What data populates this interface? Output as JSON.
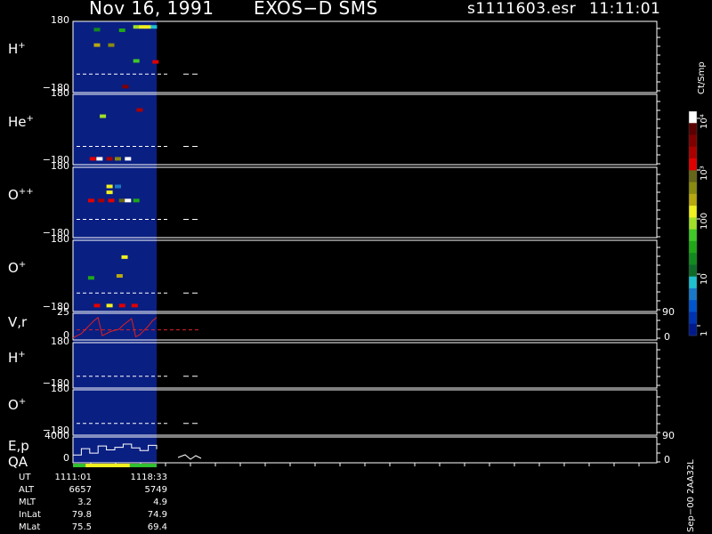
{
  "header": {
    "date": "Nov 16, 1991",
    "instrument": "EXOS−D SMS",
    "file": "s1111603.esr",
    "time": "11:11:01"
  },
  "colors": {
    "background": "#000000",
    "data_region": "#0a1f82",
    "frame": "#ffffff",
    "velocity_trace": "#e02020",
    "qa_green": "#30c030",
    "qa_yellow": "#f0f020"
  },
  "panels": [
    {
      "id": "H+",
      "label": "H",
      "sup": "+",
      "ymax": "180",
      "ymin": "−180"
    },
    {
      "id": "He+",
      "label": "He",
      "sup": "+",
      "ymax": "180",
      "ymin": "−180"
    },
    {
      "id": "O++",
      "label": "O",
      "sup": "++",
      "ymax": "180",
      "ymin": "−180"
    },
    {
      "id": "O+",
      "label": "O",
      "sup": "+",
      "ymax": "180",
      "ymin": "−180"
    },
    {
      "id": "Vr",
      "label": "V,r",
      "sup": "",
      "ymax": "25",
      "ymin": "0",
      "rmax": "90",
      "rmin": "0"
    },
    {
      "id": "H+2",
      "label": "H",
      "sup": "+",
      "ymax": "180",
      "ymin": "−180"
    },
    {
      "id": "O+2",
      "label": "O",
      "sup": "+",
      "ymax": "180",
      "ymin": "−180"
    },
    {
      "id": "Ep",
      "label": "E,p",
      "sup": "",
      "ymax": "4000",
      "ymin": "0",
      "rmax": "90",
      "rmin": "0"
    }
  ],
  "qa_label": "QA",
  "colorbar": {
    "unit": "Ct/Smp",
    "tick_labels": [
      "10⁴",
      "10³",
      "100",
      "10",
      "1"
    ],
    "colors": [
      "#001a8c",
      "#0033b0",
      "#0055cc",
      "#1a78c8",
      "#20c0d0",
      "#0f6a2a",
      "#138a20",
      "#20a818",
      "#40c828",
      "#a0e028",
      "#f0f020",
      "#b8a810",
      "#8a8a10",
      "#666618",
      "#e00000",
      "#aa0000",
      "#800000",
      "#5a0000",
      "#ffffff"
    ]
  },
  "ephemeris": {
    "rows": [
      {
        "name": "UT",
        "v1": "1111:01",
        "v2": "1118:33"
      },
      {
        "name": "ALT",
        "v1": "6657",
        "v2": "5749"
      },
      {
        "name": "MLT",
        "v1": "3.2",
        "v2": "4.9"
      },
      {
        "name": "InLat",
        "v1": "79.8",
        "v2": "74.9"
      },
      {
        "name": "MLat",
        "v1": "75.5",
        "v2": "69.4"
      }
    ]
  },
  "footer_id": "Sep−00 2AA32L",
  "chart_data": {
    "type": "heatmap",
    "title": "Nov 16, 1991 EXOS−D SMS",
    "xlabel": "UT",
    "x_ticks": [
      "1111:01",
      "1118:33"
    ],
    "colorbar_unit": "Ct/Smp",
    "colorbar_scale": "log",
    "colorbar_range": [
      1,
      10000
    ],
    "ion_panels": [
      {
        "species": "H+",
        "ylim": [
          -180,
          180
        ],
        "cells": [
          {
            "t": 0.25,
            "angle": 138,
            "level": 6
          },
          {
            "t": 0.55,
            "angle": 135,
            "level": 7
          },
          {
            "t": 0.72,
            "angle": 152,
            "level": 9
          },
          {
            "t": 0.79,
            "angle": 152,
            "level": 10
          },
          {
            "t": 0.86,
            "angle": 152,
            "level": 10
          },
          {
            "t": 0.93,
            "angle": 152,
            "level": 4
          },
          {
            "t": 0.25,
            "angle": 60,
            "level": 11
          },
          {
            "t": 0.42,
            "angle": 60,
            "level": 12
          },
          {
            "t": 0.72,
            "angle": -20,
            "level": 8
          },
          {
            "t": 0.95,
            "angle": -25,
            "level": 14
          },
          {
            "t": 0.59,
            "angle": -150,
            "level": 16
          }
        ]
      },
      {
        "species": "He+",
        "ylim": [
          -180,
          180
        ],
        "cells": [
          {
            "t": 0.76,
            "angle": 100,
            "level": 15
          },
          {
            "t": 0.32,
            "angle": 68,
            "level": 9
          },
          {
            "t": 0.2,
            "angle": -150,
            "level": 14
          },
          {
            "t": 0.28,
            "angle": -150,
            "level": 18
          },
          {
            "t": 0.4,
            "angle": -150,
            "level": 15
          },
          {
            "t": 0.5,
            "angle": -150,
            "level": 12
          },
          {
            "t": 0.62,
            "angle": -150,
            "level": 18
          }
        ]
      },
      {
        "species": "O++",
        "ylim": [
          -180,
          180
        ],
        "cells": [
          {
            "t": 0.4,
            "angle": 82,
            "level": 10
          },
          {
            "t": 0.5,
            "angle": 82,
            "level": 3
          },
          {
            "t": 0.4,
            "angle": 52,
            "level": 10
          },
          {
            "t": 0.18,
            "angle": 10,
            "level": 14
          },
          {
            "t": 0.3,
            "angle": 10,
            "level": 15
          },
          {
            "t": 0.42,
            "angle": 10,
            "level": 14
          },
          {
            "t": 0.55,
            "angle": 10,
            "level": 13
          },
          {
            "t": 0.62,
            "angle": 10,
            "level": 18
          },
          {
            "t": 0.72,
            "angle": 10,
            "level": 7
          }
        ]
      },
      {
        "species": "O+",
        "ylim": [
          -180,
          180
        ],
        "cells": [
          {
            "t": 0.58,
            "angle": 95,
            "level": 10
          },
          {
            "t": 0.52,
            "angle": 0,
            "level": 11
          },
          {
            "t": 0.18,
            "angle": -10,
            "level": 7
          },
          {
            "t": 0.25,
            "angle": -150,
            "level": 14
          },
          {
            "t": 0.4,
            "angle": -150,
            "level": 10
          },
          {
            "t": 0.55,
            "angle": -150,
            "level": 14
          },
          {
            "t": 0.7,
            "angle": -150,
            "level": 14
          }
        ]
      }
    ],
    "vr_panel": {
      "ylim": [
        0,
        25
      ],
      "right_ylim": [
        0,
        90
      ],
      "x": [
        0,
        0.05,
        0.1,
        0.15,
        0.2,
        0.25,
        0.3,
        0.35,
        0.4,
        0.45,
        0.5,
        0.55,
        0.6,
        0.65,
        0.7,
        0.75,
        0.8,
        0.85,
        0.9,
        0.95,
        1.0
      ],
      "y": [
        2,
        4,
        6,
        10,
        14,
        18,
        21,
        4,
        6,
        8,
        9,
        10,
        14,
        17,
        20,
        3,
        5,
        9,
        13,
        18,
        21
      ]
    },
    "ep_panel": {
      "ylim": [
        0,
        4000
      ],
      "right_ylim": [
        0,
        90
      ],
      "x": [
        0,
        0.1,
        0.2,
        0.3,
        0.4,
        0.5,
        0.6,
        0.7,
        0.8,
        0.9,
        1.0
      ],
      "y": [
        1200,
        2200,
        1500,
        2600,
        2000,
        2400,
        2900,
        2300,
        1900,
        2700,
        2100
      ]
    },
    "qa": {
      "segments": [
        {
          "from": 0,
          "to": 0.15,
          "color": "green"
        },
        {
          "from": 0.15,
          "to": 0.68,
          "color": "yellow"
        },
        {
          "from": 0.68,
          "to": 1.0,
          "color": "green"
        }
      ]
    }
  }
}
